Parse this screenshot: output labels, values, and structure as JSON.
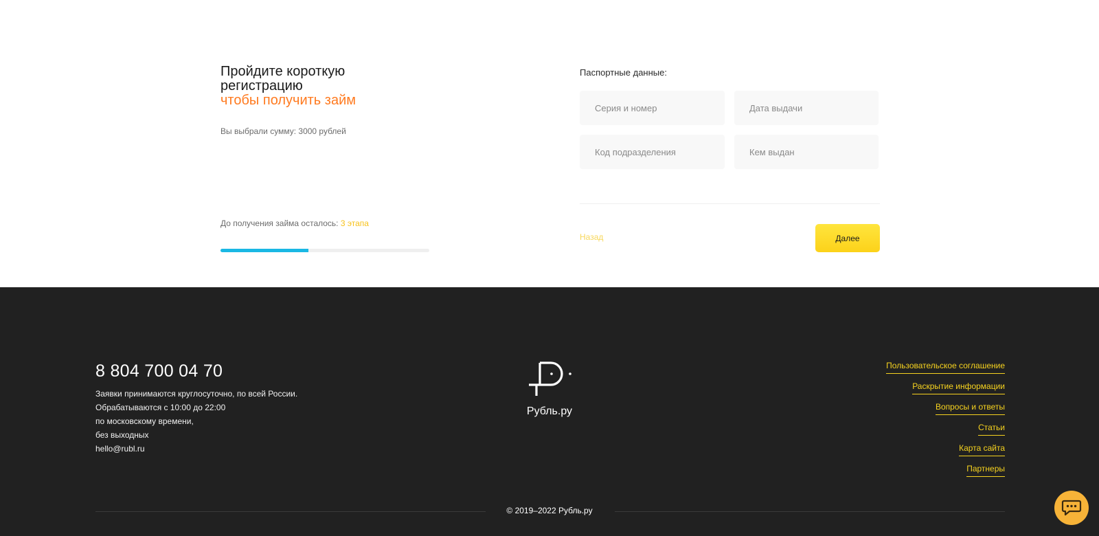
{
  "hero": {
    "title_line1": "Пройдите короткую",
    "title_line2": "регистрацию",
    "title_accent": "чтобы получить займ",
    "chosen_sum": "Вы выбрали сумму: 3000 рублей",
    "remaining_label": "До получения займа осталось: ",
    "remaining_steps": "3 этапа",
    "progress_fraction": 0.42
  },
  "form": {
    "title": "Паспортные данные:",
    "series_placeholder": "Серия и номер",
    "date_placeholder": "Дата выдачи",
    "code_placeholder": "Код подразделения",
    "issuer_placeholder": "Кем выдан",
    "back_label": "Назад",
    "next_label": "Далее"
  },
  "footer": {
    "phone": "8 804 700 04 70",
    "info_lines": [
      "Заявки принимаются круглосуточно, по всей России.",
      "Обрабатываются с 10:00 до 22:00",
      "по московскому времени,",
      "без выходных",
      "hello@rubl.ru"
    ],
    "brand": "Рубль.ру",
    "links": [
      "Пользовательское соглашение",
      "Раскрытие информации",
      "Вопросы и ответы",
      "Статьи",
      "Карта сайта",
      "Партнеры"
    ],
    "copyright": "© 2019–2022 Рубль.ру"
  },
  "icons": {
    "logo": "ruble-logo-icon",
    "chat": "chat-bubble-icon"
  },
  "colors": {
    "accent_orange": "#ff7a1f",
    "accent_yellow": "#f7d31f",
    "progress_blue": "#1ab8e4",
    "footer_bg": "#212121",
    "chat_bg": "#f7b338"
  }
}
